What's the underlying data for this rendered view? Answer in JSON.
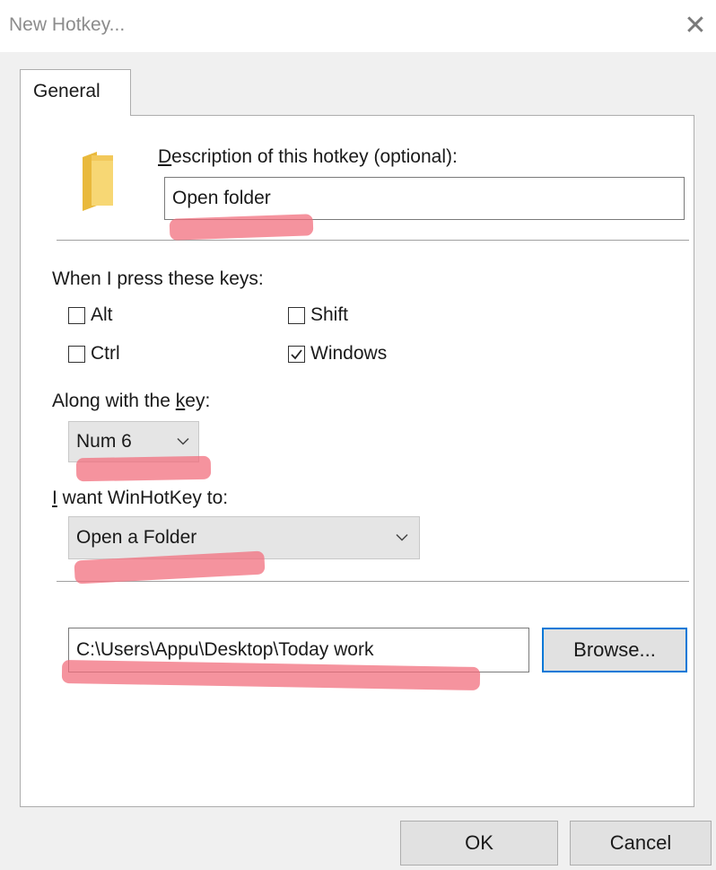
{
  "window": {
    "title": "New Hotkey...",
    "close_glyph": "✕",
    "close_icon": "close-icon"
  },
  "tabs": [
    {
      "label": "General",
      "selected": true
    }
  ],
  "description": {
    "icon": "folder-icon",
    "label_access_key": "D",
    "label_rest": "escription of this hotkey (optional):",
    "value": "Open folder"
  },
  "keys": {
    "label": "When I press these keys:",
    "modifiers": [
      {
        "label": "Alt",
        "checked": false
      },
      {
        "label": "Shift",
        "checked": false
      },
      {
        "label": "Ctrl",
        "checked": false
      },
      {
        "label": "Windows",
        "checked": true
      }
    ]
  },
  "key": {
    "label_before": "Along with the ",
    "label_access_key": "k",
    "label_after": "ey:",
    "selected": "Num 6"
  },
  "action": {
    "label_access_key": "I",
    "label_rest": " want WinHotKey to:",
    "selected": "Open a Folder"
  },
  "folder": {
    "path": "C:\\Users\\Appu\\Desktop\\Today work",
    "browse_label": "Browse..."
  },
  "footer": {
    "ok_label": "OK",
    "cancel_label": "Cancel"
  },
  "colors": {
    "highlight_marker": "#f26f7e",
    "default_button_border": "#0078d7"
  }
}
